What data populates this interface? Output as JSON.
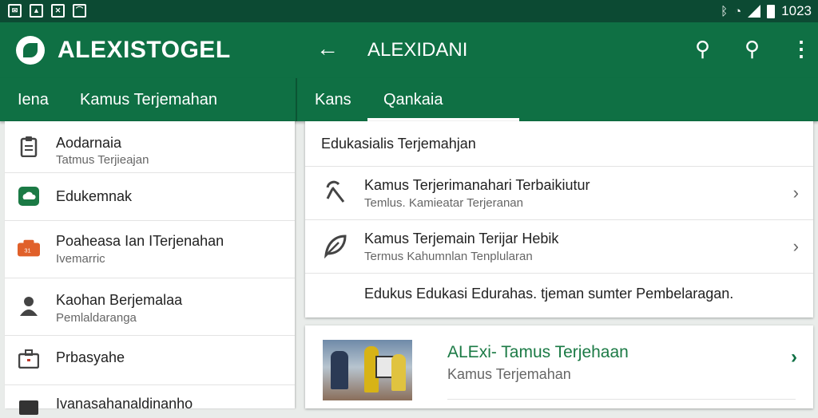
{
  "status_bar": {
    "time": "1023",
    "left_icons": [
      "mail-icon",
      "image-icon",
      "shuffle-icon",
      "chart-icon"
    ],
    "right_icons": [
      "bluetooth-icon",
      "wifi-icon",
      "signal-icon",
      "battery-icon"
    ]
  },
  "app_bar": {
    "brand": "ALEXISTOGEL",
    "title": "ALEXIDANI",
    "back_icon": "arrow-back-icon",
    "actions": [
      "search-icon",
      "search-icon",
      "more-vert-icon"
    ]
  },
  "tabs": {
    "left": [
      "Iena",
      "Kamus Terjemahan"
    ],
    "right": [
      "Kans",
      "Qankaia"
    ],
    "selected": "Qankaia"
  },
  "drawer": {
    "items": [
      {
        "title": "Aodarnaia",
        "subtitle": "Tatmus Terjieajan",
        "icon": "clipboard-icon"
      },
      {
        "title": "Edukemnak",
        "subtitle": "",
        "icon": "cloud-icon"
      },
      {
        "title": "Poaheasa Ian ITerjenahan",
        "subtitle": "Ivemarric",
        "icon": "slides-icon"
      },
      {
        "title": "Kaohan Berjemalaa",
        "subtitle": "Pemlaldaranga",
        "icon": "person-icon"
      },
      {
        "title": "Prbasyahe",
        "subtitle": "",
        "icon": "briefcase-icon"
      },
      {
        "title": "Ivanasahanaldinanho",
        "subtitle": "",
        "icon": "folder-icon"
      }
    ]
  },
  "card": {
    "header": "Edukasialis Terjemahjan",
    "rows": [
      {
        "title": "Kamus Terjerimanahari Terbaikiutur",
        "subtitle": "Temlus. Kamieatar Terjeranan",
        "icon": "pickaxe-icon"
      },
      {
        "title": "Kamus Terjemain Terijar Hebik",
        "subtitle": "Termus Kahumnlan Tenplularan",
        "icon": "leaf-icon"
      }
    ],
    "footer": "Edukus Edukasi Edurahas. tjeman sumter Pembelaragan."
  },
  "card2": {
    "title": "ALExi- Tamus Terjehaan",
    "subtitle": "Kamus Terjemahan",
    "thumbnail": "photo-people-thumbnail"
  },
  "colors": {
    "status_bar": "#0c4a33",
    "primary": "#0f7044",
    "accent_text": "#1b7a45",
    "background": "#e9ecea"
  }
}
